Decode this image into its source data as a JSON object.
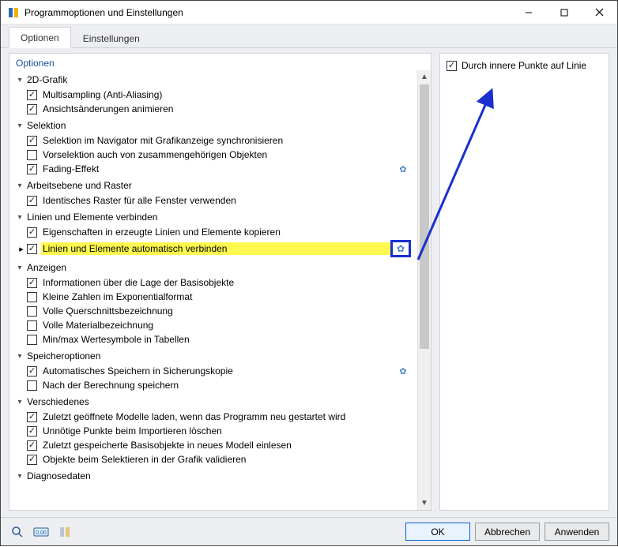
{
  "window": {
    "title": "Programmoptionen und Einstellungen"
  },
  "tabs": {
    "options": "Optionen",
    "settings": "Einstellungen"
  },
  "pane_title": "Optionen",
  "groups": [
    {
      "title": "2D-Grafik",
      "items": [
        {
          "label": "Multisampling (Anti-Aliasing)",
          "checked": true
        },
        {
          "label": "Ansichtsänderungen animieren",
          "checked": true
        }
      ]
    },
    {
      "title": "Selektion",
      "items": [
        {
          "label": "Selektion im Navigator mit Grafikanzeige synchronisieren",
          "checked": true
        },
        {
          "label": "Vorselektion auch von zusammengehörigen Objekten",
          "checked": false
        },
        {
          "label": "Fading-Effekt",
          "checked": true,
          "gear": true
        }
      ]
    },
    {
      "title": "Arbeitsebene und Raster",
      "items": [
        {
          "label": "Identisches Raster für alle Fenster verwenden",
          "checked": true
        }
      ]
    },
    {
      "title": "Linien und Elemente verbinden",
      "items": [
        {
          "label": "Eigenschaften in erzeugte Linien und Elemente kopieren",
          "checked": true
        },
        {
          "label": "Linien und Elemente automatisch verbinden",
          "checked": true,
          "highlight": true,
          "marker": true,
          "gearbox": true
        }
      ]
    },
    {
      "title": "Anzeigen",
      "items": [
        {
          "label": "Informationen über die Lage der Basisobjekte",
          "checked": true
        },
        {
          "label": "Kleine Zahlen im Exponentialformat",
          "checked": false
        },
        {
          "label": "Volle Querschnittsbezeichnung",
          "checked": false
        },
        {
          "label": "Volle Materialbezeichnung",
          "checked": false
        },
        {
          "label": "Min/max Wertesymbole in Tabellen",
          "checked": false
        }
      ]
    },
    {
      "title": "Speicheroptionen",
      "items": [
        {
          "label": "Automatisches Speichern in Sicherungskopie",
          "checked": true,
          "gear": true
        },
        {
          "label": "Nach der Berechnung speichern",
          "checked": false
        }
      ]
    },
    {
      "title": "Verschiedenes",
      "items": [
        {
          "label": "Zuletzt geöffnete Modelle laden, wenn das Programm neu gestartet wird",
          "checked": true
        },
        {
          "label": "Unnötige Punkte beim Importieren löschen",
          "checked": true
        },
        {
          "label": "Zuletzt gespeicherte Basisobjekte in neues Modell einlesen",
          "checked": true
        },
        {
          "label": "Objekte beim Selektieren in der Grafik validieren",
          "checked": true
        }
      ]
    },
    {
      "title": "Diagnosedaten",
      "items": []
    }
  ],
  "right_panel": {
    "label": "Durch innere Punkte auf Linie",
    "checked": true
  },
  "buttons": {
    "ok": "OK",
    "cancel": "Abbrechen",
    "apply": "Anwenden"
  },
  "annotation": {
    "color": "#1a2fd0"
  }
}
